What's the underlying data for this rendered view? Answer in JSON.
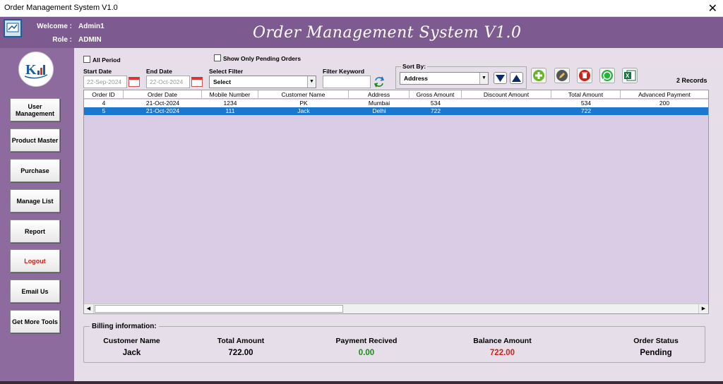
{
  "window": {
    "title": "Order Management System V1.0"
  },
  "header": {
    "welcome_label": "Welcome :",
    "welcome_value": "Admin1",
    "role_label": "Role :",
    "role_value": "ADMIN",
    "app_title": "Order Management System V1.0"
  },
  "sidebar": {
    "items": [
      {
        "label": "User Management"
      },
      {
        "label": "Product Master"
      },
      {
        "label": "Purchase"
      },
      {
        "label": "Manage List"
      },
      {
        "label": "Report"
      },
      {
        "label": "Logout"
      },
      {
        "label": "Email Us"
      },
      {
        "label": "Get More Tools"
      }
    ]
  },
  "filters": {
    "all_period_label": "All Period",
    "pending_only_label": "Show Only Pending Orders",
    "start_date_label": "Start Date",
    "start_date_value": "22-Sep-2024",
    "end_date_label": "End Date",
    "end_date_value": "22-Oct-2024",
    "select_filter_label": "Select Filter",
    "select_filter_value": "Select",
    "filter_keyword_label": "Filter Keyword",
    "filter_keyword_value": "",
    "sort_by_label": "Sort By:",
    "sort_by_value": "Address",
    "records_text": "2 Records"
  },
  "toolbar_icons": [
    "sort-desc-icon",
    "sort-asc-icon",
    "add-icon",
    "edit-icon",
    "delete-icon",
    "whatsapp-icon",
    "excel-icon"
  ],
  "table": {
    "columns": [
      "Order ID",
      "Order Date",
      "Mobile Number",
      "Customer Name",
      "Address",
      "Gross Amount",
      "Discount Amount",
      "Total Amount",
      "Advanced Payment"
    ],
    "rows": [
      [
        "4",
        "21-Oct-2024",
        "1234",
        "PK",
        "Mumbai",
        "534",
        "",
        "534",
        "200"
      ],
      [
        "5",
        "21-Oct-2024",
        "111",
        "Jack",
        "Delhi",
        "722",
        "",
        "722",
        ""
      ]
    ],
    "selected_row_index": 1
  },
  "billing": {
    "legend": "Billing information:",
    "customer_name_label": "Customer Name",
    "customer_name_value": "Jack",
    "total_amount_label": "Total Amount",
    "total_amount_value": "722.00",
    "payment_received_label": "Payment Recived",
    "payment_received_value": "0.00",
    "balance_amount_label": "Balance Amount",
    "balance_amount_value": "722.00",
    "order_status_label": "Order Status",
    "order_status_value": "Pending"
  },
  "colors": {
    "header_bg": "#7d5a8f",
    "sidebar_bg": "#8d6b9e",
    "main_bg": "#e6dfea",
    "selected_row": "#1a78d0",
    "logout_text": "#d0201a",
    "payment_green": "#1a8a1a",
    "balance_red": "#d0201a"
  }
}
